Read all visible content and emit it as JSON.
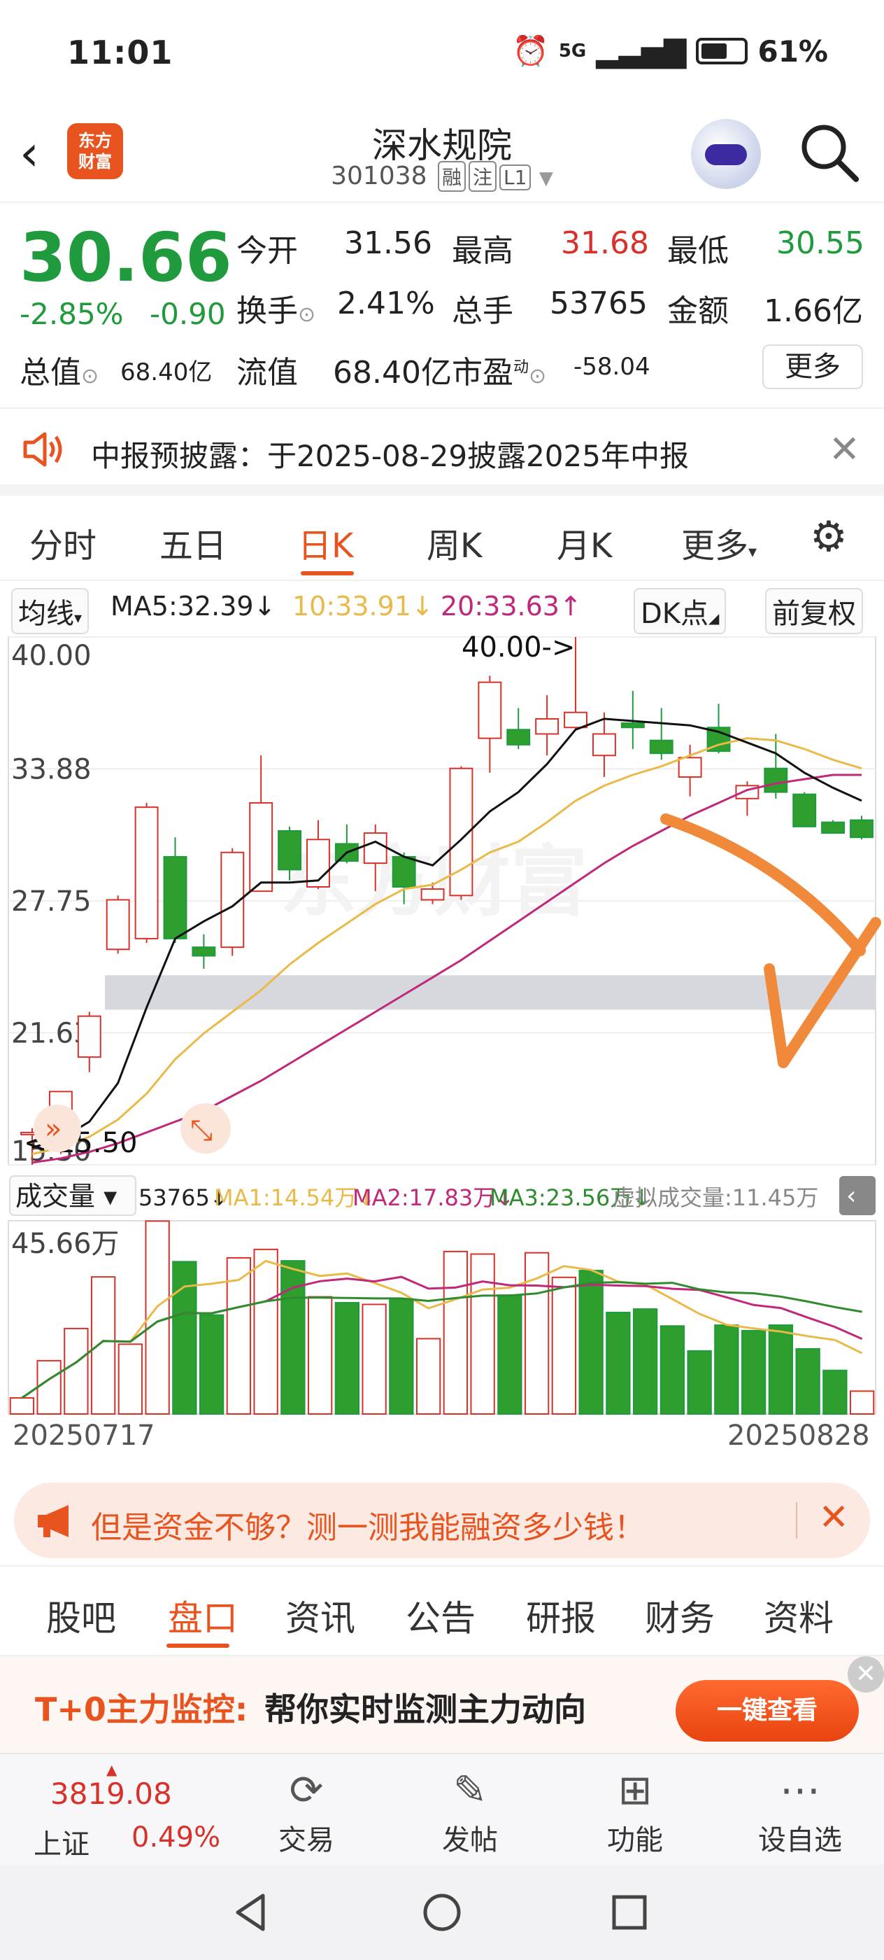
{
  "status": {
    "time": "11:01",
    "network": "5G",
    "battery": "61%"
  },
  "header": {
    "back_icon": "chevron-left-icon",
    "logo_text_1": "东方",
    "logo_text_2": "财富",
    "stock_name": "深水规院",
    "stock_code": "301038",
    "tag1": "融",
    "tag2": "注",
    "tag3": "L1"
  },
  "quote": {
    "price": "30.66",
    "change_pct": "-2.85%",
    "change": "-0.90",
    "open_label": "今开",
    "open": "31.56",
    "high_label": "最高",
    "high": "31.68",
    "low_label": "最低",
    "low": "30.55",
    "turnover_label": "换手",
    "turnover": "2.41%",
    "volume_label": "总手",
    "volume": "53765",
    "amount_label": "金额",
    "amount": "1.66亿",
    "mktcap_label": "总值",
    "mktcap": "68.40亿",
    "float_label": "流值",
    "float": "68.40亿",
    "pe_label": "市盈",
    "pe_sup": "动",
    "pe": "-58.04",
    "more": "更多"
  },
  "notice": {
    "text": "中报预披露：于2025-08-29披露2025年中报"
  },
  "tabs": [
    "分时",
    "五日",
    "日K",
    "周K",
    "月K",
    "更多"
  ],
  "ma": {
    "selector": "均线",
    "ma5": "MA5:32.39↓",
    "ma10": "10:33.91↓",
    "ma20": "20:33.63↑",
    "dk": "DK点",
    "adj": "前复权",
    "ma5_color": "#111111",
    "ma10_color": "#e9b949",
    "ma20_color": "#c0287a"
  },
  "chart_data": [
    {
      "type": "candlestick",
      "title": "",
      "y_ticks": [
        "40.00",
        "33.88",
        "27.75",
        "21.63",
        "15.50"
      ],
      "ylim": [
        15.5,
        40.0
      ],
      "high_annotation": "40.00->",
      "low_annotation": "15.50",
      "candles": [
        {
          "o": 17.0,
          "h": 17.2,
          "l": 15.5,
          "c": 17.0,
          "up": true
        },
        {
          "o": 17.6,
          "h": 18.9,
          "l": 16.0,
          "c": 18.9,
          "up": true
        },
        {
          "o": 20.5,
          "h": 22.6,
          "l": 19.8,
          "c": 22.4,
          "up": true
        },
        {
          "o": 25.5,
          "h": 28.0,
          "l": 25.3,
          "c": 27.8,
          "up": true
        },
        {
          "o": 26.0,
          "h": 32.3,
          "l": 25.8,
          "c": 32.1,
          "up": true
        },
        {
          "o": 29.8,
          "h": 30.7,
          "l": 25.8,
          "c": 26.0,
          "up": false
        },
        {
          "o": 25.6,
          "h": 26.2,
          "l": 24.6,
          "c": 25.2,
          "up": false
        },
        {
          "o": 25.6,
          "h": 30.2,
          "l": 25.2,
          "c": 30.0,
          "up": true
        },
        {
          "o": 28.2,
          "h": 34.5,
          "l": 28.2,
          "c": 32.3,
          "up": true
        },
        {
          "o": 31.0,
          "h": 31.2,
          "l": 28.7,
          "c": 29.2,
          "up": false
        },
        {
          "o": 28.4,
          "h": 31.5,
          "l": 28.3,
          "c": 30.6,
          "up": true
        },
        {
          "o": 30.4,
          "h": 31.3,
          "l": 29.5,
          "c": 29.6,
          "up": false
        },
        {
          "o": 29.5,
          "h": 31.3,
          "l": 28.2,
          "c": 30.9,
          "up": true
        },
        {
          "o": 29.8,
          "h": 30.0,
          "l": 27.6,
          "c": 28.4,
          "up": false
        },
        {
          "o": 27.8,
          "h": 28.6,
          "l": 27.6,
          "c": 28.3,
          "up": true
        },
        {
          "o": 28.0,
          "h": 34.0,
          "l": 27.8,
          "c": 33.9,
          "up": true
        },
        {
          "o": 35.3,
          "h": 38.2,
          "l": 33.7,
          "c": 37.9,
          "up": true
        },
        {
          "o": 35.7,
          "h": 36.7,
          "l": 34.8,
          "c": 35.0,
          "up": false
        },
        {
          "o": 35.5,
          "h": 37.3,
          "l": 34.5,
          "c": 36.2,
          "up": true
        },
        {
          "o": 35.8,
          "h": 40.0,
          "l": 35.7,
          "c": 36.5,
          "up": true
        },
        {
          "o": 34.5,
          "h": 36.5,
          "l": 33.5,
          "c": 35.5,
          "up": true
        },
        {
          "o": 36.0,
          "h": 37.5,
          "l": 34.8,
          "c": 35.8,
          "up": false
        },
        {
          "o": 35.2,
          "h": 36.7,
          "l": 34.3,
          "c": 34.6,
          "up": false
        },
        {
          "o": 33.5,
          "h": 35.0,
          "l": 32.6,
          "c": 34.4,
          "up": true
        },
        {
          "o": 35.8,
          "h": 36.9,
          "l": 34.6,
          "c": 34.7,
          "up": false
        },
        {
          "o": 32.5,
          "h": 33.3,
          "l": 31.7,
          "c": 33.1,
          "up": true
        },
        {
          "o": 33.9,
          "h": 35.5,
          "l": 32.5,
          "c": 32.8,
          "up": false
        },
        {
          "o": 32.7,
          "h": 32.8,
          "l": 31.2,
          "c": 31.2,
          "up": false
        },
        {
          "o": 31.4,
          "h": 31.5,
          "l": 30.9,
          "c": 30.9,
          "up": false
        },
        {
          "o": 31.5,
          "h": 31.7,
          "l": 30.6,
          "c": 30.7,
          "up": false
        }
      ],
      "ma5": [
        16.3,
        16.7,
        17.5,
        19.3,
        22.8,
        26.0,
        26.8,
        27.5,
        28.6,
        28.6,
        28.7,
        30.0,
        30.5,
        29.8,
        29.4,
        30.6,
        31.9,
        32.8,
        34.1,
        35.7,
        36.2,
        36.1,
        36.0,
        35.9,
        35.6,
        35.1,
        34.6,
        33.7,
        33.0,
        32.4
      ],
      "ma10": [
        16.0,
        16.3,
        16.8,
        17.6,
        18.8,
        20.4,
        21.6,
        22.6,
        23.6,
        24.8,
        25.8,
        26.7,
        27.6,
        28.3,
        28.5,
        29.2,
        30.0,
        30.5,
        31.4,
        32.4,
        33.1,
        33.6,
        34.0,
        34.5,
        35.0,
        35.3,
        35.2,
        34.8,
        34.3,
        33.9
      ],
      "ma20": [
        15.6,
        15.8,
        16.1,
        16.5,
        17.0,
        17.5,
        18.0,
        18.7,
        19.4,
        20.2,
        21.0,
        21.8,
        22.6,
        23.4,
        24.2,
        25.0,
        25.9,
        26.8,
        27.7,
        28.6,
        29.5,
        30.3,
        31.0,
        31.7,
        32.3,
        32.9,
        33.2,
        33.4,
        33.6,
        33.6
      ]
    },
    {
      "type": "bar",
      "title": "",
      "label": "成交量",
      "series_label": "53765↓",
      "ma1": "MA1:14.54万↓",
      "ma2": "MA2:17.83万↓",
      "ma3": "MA3:23.56万↓",
      "virtual": "虚拟成交量:11.45万",
      "y_tick": "45.66万",
      "x_start": "20250717",
      "x_end": "20250828",
      "ylim": [
        0,
        45.66
      ],
      "values": [
        3.8,
        12.6,
        20.2,
        32.4,
        16.5,
        45.6,
        36.0,
        23.4,
        36.9,
        38.9,
        36.2,
        27.7,
        26.3,
        25.9,
        27.2,
        17.8,
        38.4,
        37.8,
        28.1,
        38.1,
        32.3,
        33.9,
        24.0,
        24.8,
        20.8,
        14.9,
        21.0,
        19.7,
        21.0,
        15.4,
        10.3,
        5.4
      ],
      "up": [
        true,
        true,
        true,
        true,
        true,
        true,
        false,
        false,
        true,
        true,
        false,
        true,
        false,
        true,
        false,
        true,
        true,
        true,
        false,
        true,
        true,
        false,
        false,
        false,
        false,
        false,
        false,
        false,
        false,
        false,
        false,
        true
      ]
    }
  ],
  "promo": {
    "text": "但是资金不够？测一测我能融资多少钱！"
  },
  "bottom_tabs": [
    "股吧",
    "盘口",
    "资讯",
    "公告",
    "研报",
    "财务",
    "资料"
  ],
  "t0": {
    "title": "T+0主力监控:",
    "desc": "帮你实时监测主力动向",
    "button": "一键查看"
  },
  "nav": {
    "index_value": "3819.08",
    "index_name": "上证",
    "index_pct": "0.49%",
    "trade": "交易",
    "post": "发帖",
    "func": "功能",
    "watch": "设自选"
  }
}
